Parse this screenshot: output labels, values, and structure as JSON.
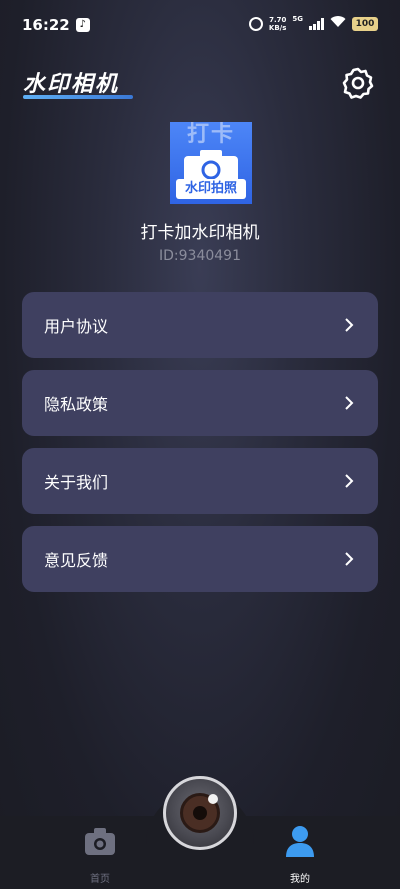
{
  "status_bar": {
    "time": "16:22",
    "app_icon": "tiktok-icon",
    "net_speed_value": "7.70",
    "net_speed_unit": "KB/s",
    "network_type": "5G",
    "battery": "100"
  },
  "header": {
    "title": "水印相机",
    "settings_icon": "gear-icon",
    "underline_color": "#4a95ef"
  },
  "profile": {
    "logo": {
      "top_text": "打卡",
      "caption": "水印拍照"
    },
    "name": "打卡加水印相机",
    "id": "ID:9340491"
  },
  "menu": {
    "items": [
      {
        "label": "用户协议"
      },
      {
        "label": "隐私政策"
      },
      {
        "label": "关于我们"
      },
      {
        "label": "意见反馈"
      }
    ]
  },
  "tab_bar": {
    "tabs": [
      {
        "label": "首页",
        "icon": "camera-icon",
        "active": false
      },
      {
        "label": "我的",
        "icon": "user-icon",
        "active": true
      }
    ],
    "center_button_icon": "shutter-lens-icon",
    "active_color": "#3d9bf0"
  },
  "colors": {
    "menu_item_bg": "#3f4060",
    "background": "#1e1f2a",
    "logo_blue": "#2f64e4"
  }
}
